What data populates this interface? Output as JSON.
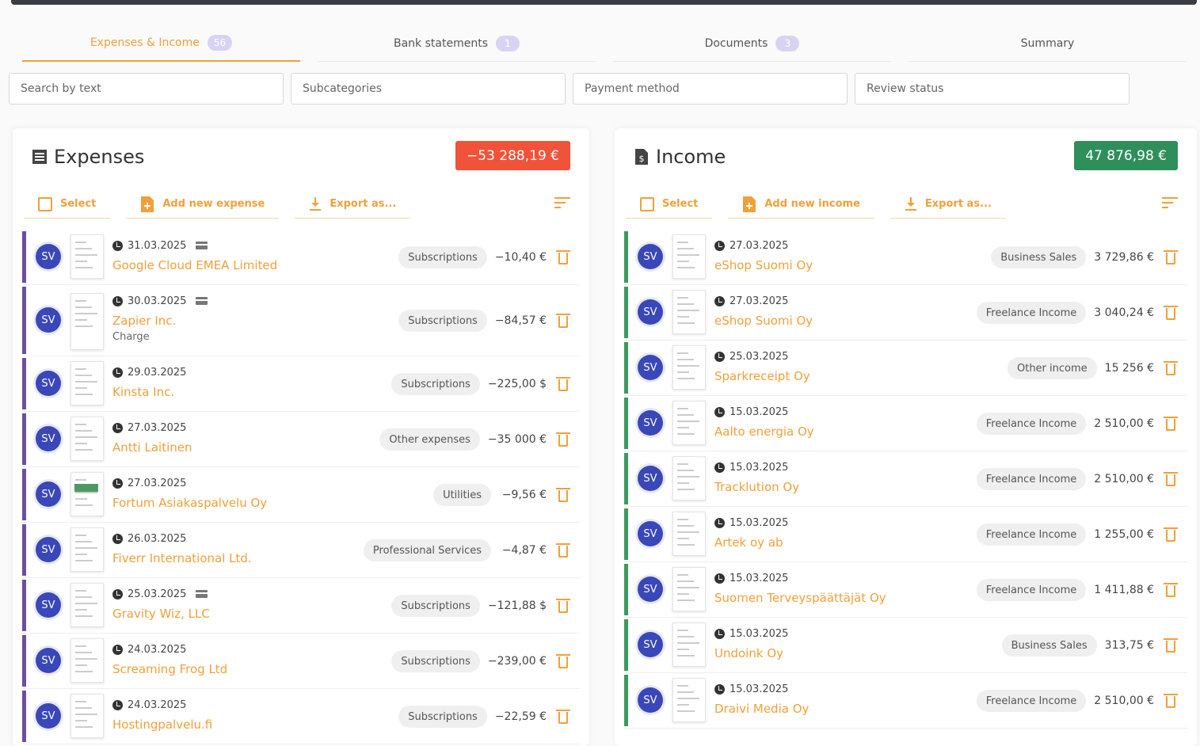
{
  "tabs": [
    {
      "label": "Expenses & Income",
      "count": "56",
      "active": true
    },
    {
      "label": "Bank statements",
      "count": "1"
    },
    {
      "label": "Documents",
      "count": "3"
    },
    {
      "label": "Summary",
      "count": ""
    }
  ],
  "filters": {
    "search_placeholder": "Search by text",
    "subcategories": "Subcategories",
    "payment_method": "Payment method",
    "review_status": "Review status"
  },
  "expenses": {
    "title": "Expenses",
    "total": "−53 288,19 €",
    "select_label": "Select",
    "add_label": "Add new expense",
    "export_label": "Export as...",
    "rows": [
      {
        "avatar": "SV",
        "date": "31.03.2025",
        "card": true,
        "name": "Google Cloud EMEA Limited",
        "sub": "",
        "category": "Subscriptions",
        "amount": "−10,40 €"
      },
      {
        "avatar": "SV",
        "date": "30.03.2025",
        "card": true,
        "name": "Zapier Inc.",
        "sub": "Charge",
        "category": "Subscriptions",
        "amount": "−84,57 €"
      },
      {
        "avatar": "SV",
        "date": "29.03.2025",
        "card": false,
        "name": "Kinsta Inc.",
        "sub": "",
        "category": "Subscriptions",
        "amount": "−225,00 $"
      },
      {
        "avatar": "SV",
        "date": "27.03.2025",
        "card": false,
        "name": "Antti Laitinen",
        "sub": "",
        "category": "Other expenses",
        "amount": "−35 000 €"
      },
      {
        "avatar": "SV",
        "date": "27.03.2025",
        "card": false,
        "name": "Fortum Asiakaspalvelu Oy",
        "sub": "",
        "category": "Utilities",
        "amount": "−9,56 €"
      },
      {
        "avatar": "SV",
        "date": "26.03.2025",
        "card": false,
        "name": "Fiverr International Ltd.",
        "sub": "",
        "category": "Professional Services",
        "amount": "−4,87 €"
      },
      {
        "avatar": "SV",
        "date": "25.03.2025",
        "card": true,
        "name": "Gravity Wiz, LLC",
        "sub": "",
        "category": "Subscriptions",
        "amount": "−121,88 $"
      },
      {
        "avatar": "SV",
        "date": "24.03.2025",
        "card": false,
        "name": "Screaming Frog Ltd",
        "sub": "",
        "category": "Subscriptions",
        "amount": "−239,00 €"
      },
      {
        "avatar": "SV",
        "date": "24.03.2025",
        "card": false,
        "name": "Hostingpalvelu.fi",
        "sub": "",
        "category": "Subscriptions",
        "amount": "−22,59 €"
      }
    ]
  },
  "income": {
    "title": "Income",
    "total": "47 876,98 €",
    "select_label": "Select",
    "add_label": "Add new income",
    "export_label": "Export as...",
    "rows": [
      {
        "avatar": "SV",
        "date": "27.03.2025",
        "name": "eShop Suomi Oy",
        "category": "Business Sales",
        "amount": "3 729,86 €"
      },
      {
        "avatar": "SV",
        "date": "27.03.2025",
        "name": "eShop Suomi Oy",
        "category": "Freelance Income",
        "amount": "3 040,24 €"
      },
      {
        "avatar": "SV",
        "date": "25.03.2025",
        "name": "Sparkreceipt Oy",
        "category": "Other income",
        "amount": "15 256 €"
      },
      {
        "avatar": "SV",
        "date": "15.03.2025",
        "name": "Aalto energia Oy",
        "category": "Freelance Income",
        "amount": "2 510,00 €"
      },
      {
        "avatar": "SV",
        "date": "15.03.2025",
        "name": "Tracklution Oy",
        "category": "Freelance Income",
        "amount": "2 510,00 €"
      },
      {
        "avatar": "SV",
        "date": "15.03.2025",
        "name": "Artek oy ab",
        "category": "Freelance Income",
        "amount": "1 255,00 €"
      },
      {
        "avatar": "SV",
        "date": "15.03.2025",
        "name": "Suomen Terveyspäättäjät Oy",
        "category": "Freelance Income",
        "amount": "1 411,88 €"
      },
      {
        "avatar": "SV",
        "date": "15.03.2025",
        "name": "Undoink Oy",
        "category": "Business Sales",
        "amount": "313,75 €"
      },
      {
        "avatar": "SV",
        "date": "15.03.2025",
        "name": "Draivi Media Oy",
        "category": "Freelance Income",
        "amount": "2 510,00 €"
      }
    ]
  },
  "colors": {
    "accent": "#f0a03a",
    "expense_total": "#f0533a",
    "income_total": "#2f8f5b",
    "avatar": "#3a47b8",
    "tab_badge": "#d8d3f3"
  }
}
